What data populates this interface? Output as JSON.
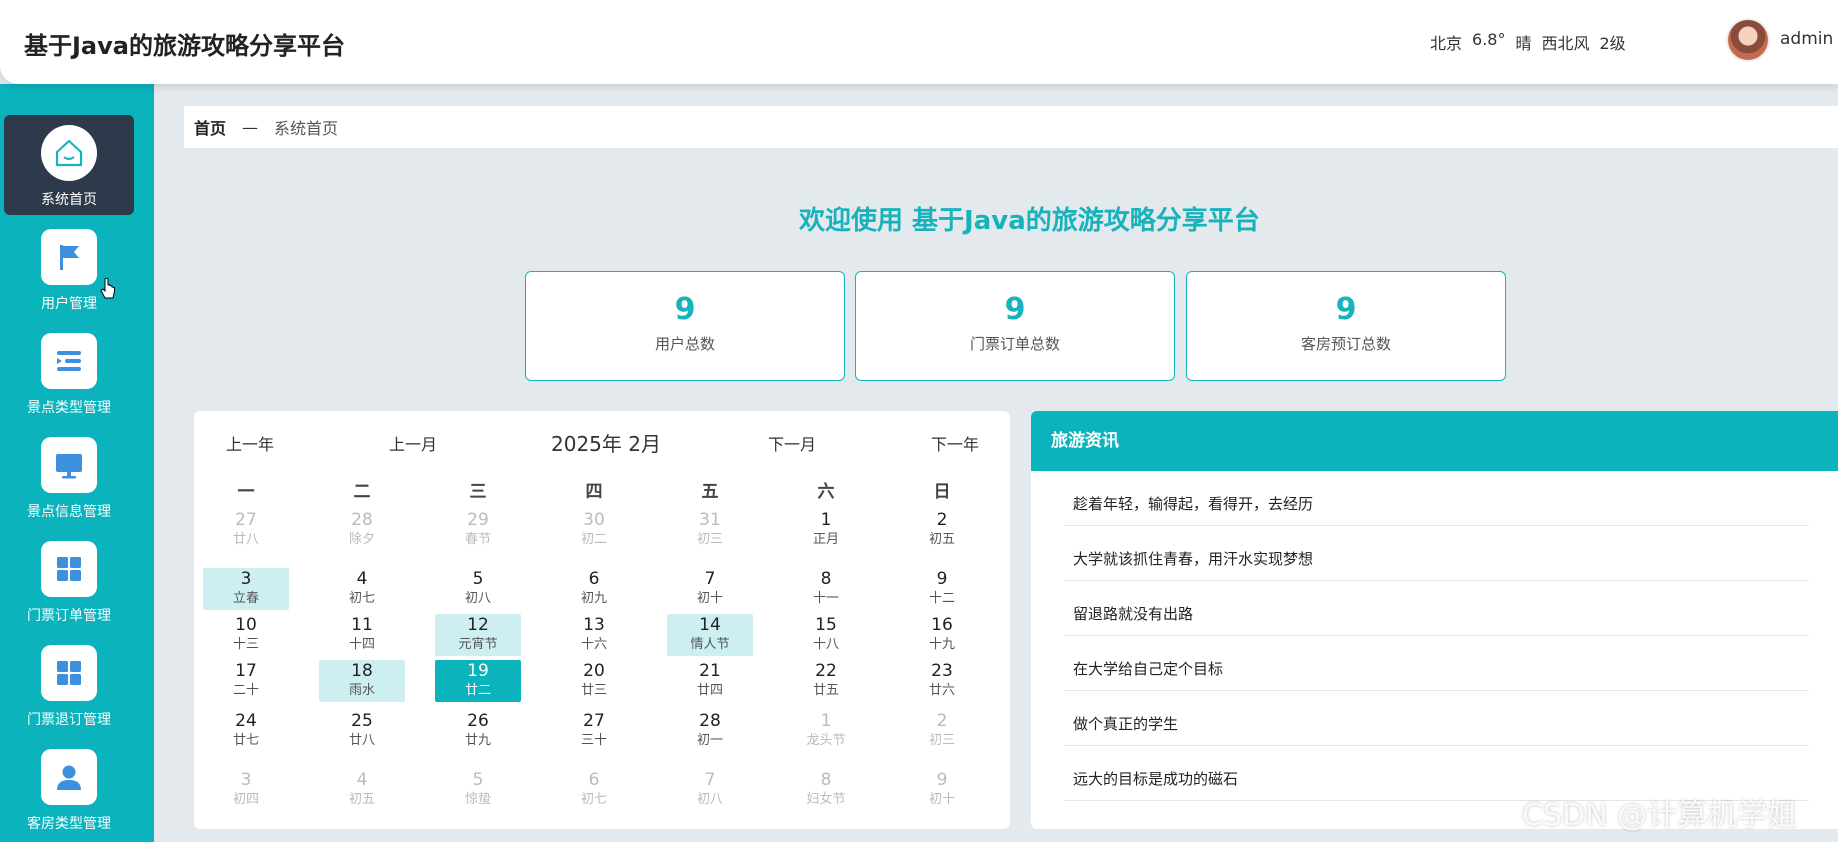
{
  "header": {
    "title": "基于Java的旅游攻略分享平台",
    "weather": {
      "city": "北京",
      "temp": "6.8°",
      "condition": "晴",
      "wind": "西北风",
      "level": "2级"
    },
    "user": "admin"
  },
  "sidebar": {
    "items": [
      {
        "label": "系统首页",
        "icon": "home-icon"
      },
      {
        "label": "用户管理",
        "icon": "flag-icon"
      },
      {
        "label": "景点类型管理",
        "icon": "list-icon"
      },
      {
        "label": "景点信息管理",
        "icon": "monitor-icon"
      },
      {
        "label": "门票订单管理",
        "icon": "grid-icon"
      },
      {
        "label": "门票退订管理",
        "icon": "grid-icon"
      },
      {
        "label": "客房类型管理",
        "icon": "user-icon"
      }
    ]
  },
  "breadcrumb": {
    "home": "首页",
    "separator": "—",
    "current": "系统首页"
  },
  "welcome": "欢迎使用 基于Java的旅游攻略分享平台",
  "stats": [
    {
      "value": "9",
      "label": "用户总数"
    },
    {
      "value": "9",
      "label": "门票订单总数"
    },
    {
      "value": "9",
      "label": "客房预订总数"
    }
  ],
  "calendar": {
    "prev_year": "上一年",
    "prev_month": "上一月",
    "title": "2025年 2月",
    "next_month": "下一月",
    "next_year": "下一年",
    "weekdays": [
      "一",
      "二",
      "三",
      "四",
      "五",
      "六",
      "日"
    ],
    "weeks": [
      [
        {
          "d": "27",
          "l": "廿八",
          "o": true
        },
        {
          "d": "28",
          "l": "除夕",
          "o": true
        },
        {
          "d": "29",
          "l": "春节",
          "o": true
        },
        {
          "d": "30",
          "l": "初二",
          "o": true
        },
        {
          "d": "31",
          "l": "初三",
          "o": true
        },
        {
          "d": "1",
          "l": "正月"
        },
        {
          "d": "2",
          "l": "初五"
        }
      ],
      [
        {
          "d": "3",
          "l": "立春",
          "h": true
        },
        {
          "d": "4",
          "l": "初七"
        },
        {
          "d": "5",
          "l": "初八"
        },
        {
          "d": "6",
          "l": "初九"
        },
        {
          "d": "7",
          "l": "初十"
        },
        {
          "d": "8",
          "l": "十一"
        },
        {
          "d": "9",
          "l": "十二"
        }
      ],
      [
        {
          "d": "10",
          "l": "十三"
        },
        {
          "d": "11",
          "l": "十四"
        },
        {
          "d": "12",
          "l": "元宵节",
          "h": true
        },
        {
          "d": "13",
          "l": "十六"
        },
        {
          "d": "14",
          "l": "情人节",
          "h": true
        },
        {
          "d": "15",
          "l": "十八"
        },
        {
          "d": "16",
          "l": "十九"
        }
      ],
      [
        {
          "d": "17",
          "l": "二十"
        },
        {
          "d": "18",
          "l": "雨水",
          "h": true
        },
        {
          "d": "19",
          "l": "廿二",
          "t": true
        },
        {
          "d": "20",
          "l": "廿三"
        },
        {
          "d": "21",
          "l": "廿四"
        },
        {
          "d": "22",
          "l": "廿五"
        },
        {
          "d": "23",
          "l": "廿六"
        }
      ],
      [
        {
          "d": "24",
          "l": "廿七"
        },
        {
          "d": "25",
          "l": "廿八"
        },
        {
          "d": "26",
          "l": "廿九"
        },
        {
          "d": "27",
          "l": "三十"
        },
        {
          "d": "28",
          "l": "初一"
        },
        {
          "d": "1",
          "l": "龙头节",
          "o": true
        },
        {
          "d": "2",
          "l": "初三",
          "o": true
        }
      ],
      [
        {
          "d": "3",
          "l": "初四",
          "o": true
        },
        {
          "d": "4",
          "l": "初五",
          "o": true
        },
        {
          "d": "5",
          "l": "惊蛰",
          "o": true
        },
        {
          "d": "6",
          "l": "初七",
          "o": true
        },
        {
          "d": "7",
          "l": "初八",
          "o": true
        },
        {
          "d": "8",
          "l": "妇女节",
          "o": true
        },
        {
          "d": "9",
          "l": "初十",
          "o": true
        }
      ]
    ]
  },
  "news": {
    "title": "旅游资讯",
    "items": [
      "趁着年轻，输得起，看得开，去经历",
      "大学就该抓住青春，用汗水实现梦想",
      "留退路就没有出路",
      "在大学给自己定个目标",
      "做个真正的学生",
      "远大的目标是成功的磁石"
    ]
  },
  "watermark": "CSDN @计算机学姐",
  "colors": {
    "accent": "#0bb3bd",
    "sidebar_active": "#2d3a4b",
    "holiday": "#cdeff2"
  }
}
